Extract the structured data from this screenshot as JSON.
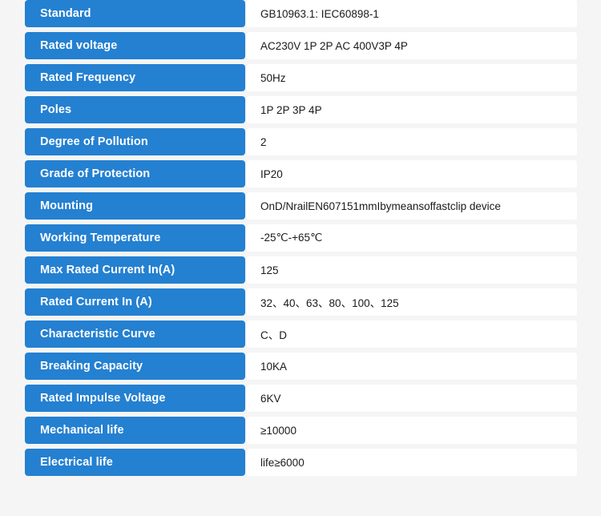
{
  "page": {
    "background_color": "#f5f5f5",
    "label_color": "#2480d1",
    "label_text_color": "#ffffff",
    "value_background_color": "#ffffff",
    "value_text_color": "#1a1a1a"
  },
  "spec_table": {
    "rows": [
      {
        "label": "Standard",
        "value": "GB10963.1: IEC60898-1"
      },
      {
        "label": "Rated voltage",
        "value": "AC230V 1P 2P AC 400V3P 4P"
      },
      {
        "label": "Rated Frequency",
        "value": "50Hz"
      },
      {
        "label": "Poles",
        "value": "1P 2P 3P 4P"
      },
      {
        "label": "Degree of Pollution",
        "value": "2"
      },
      {
        "label": "Grade of Protection",
        "value": "IP20"
      },
      {
        "label": "Mounting",
        "value": "OnD/NrailEN607151mmIbymeansoffastclip device"
      },
      {
        "label": "Working Temperature",
        "value": "-25℃-+65℃"
      },
      {
        "label": "Max Rated Current In(A)",
        "value": "125"
      },
      {
        "label": "Rated Current In (A)",
        "value": "32、40、63、80、100、125"
      },
      {
        "label": "Characteristic Curve",
        "value": "C、D"
      },
      {
        "label": "Breaking Capacity",
        "value": "10KA"
      },
      {
        "label": "Rated Impulse Voltage",
        "value": "6KV"
      },
      {
        "label": "Mechanical life",
        "value": "≥10000"
      },
      {
        "label": "Electrical life",
        "value": "life≥6000"
      }
    ]
  }
}
